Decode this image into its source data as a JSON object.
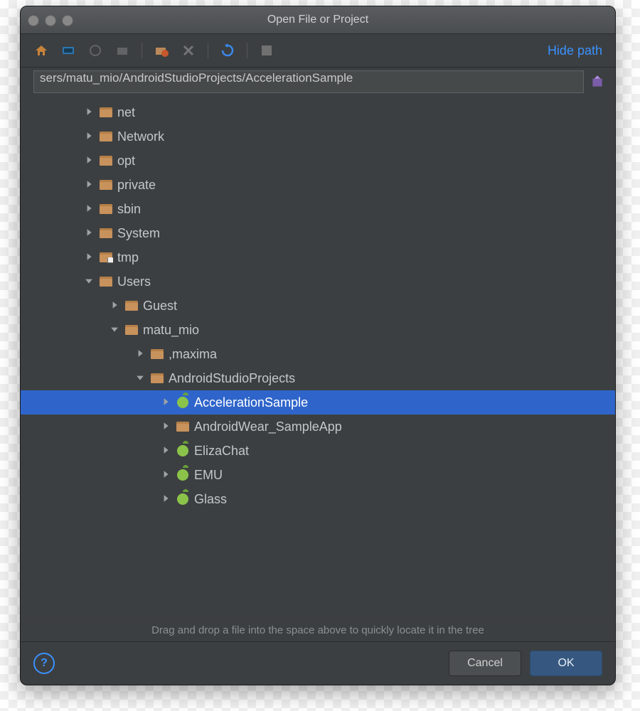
{
  "window": {
    "title": "Open File or Project"
  },
  "toolbar": {
    "hide_path_label": "Hide path"
  },
  "path": {
    "value": "sers/matu_mio/AndroidStudioProjects/AccelerationSample"
  },
  "tree": {
    "items": [
      {
        "indent": 1,
        "expanded": false,
        "icon": "folder",
        "label": "net"
      },
      {
        "indent": 1,
        "expanded": false,
        "icon": "folder",
        "label": "Network"
      },
      {
        "indent": 1,
        "expanded": false,
        "icon": "folder",
        "label": "opt"
      },
      {
        "indent": 1,
        "expanded": false,
        "icon": "folder",
        "label": "private"
      },
      {
        "indent": 1,
        "expanded": false,
        "icon": "folder",
        "label": "sbin"
      },
      {
        "indent": 1,
        "expanded": false,
        "icon": "folder",
        "label": "System"
      },
      {
        "indent": 1,
        "expanded": false,
        "icon": "folder-shortcut",
        "label": "tmp"
      },
      {
        "indent": 1,
        "expanded": true,
        "icon": "folder",
        "label": "Users"
      },
      {
        "indent": 2,
        "expanded": false,
        "icon": "folder",
        "label": "Guest"
      },
      {
        "indent": 2,
        "expanded": true,
        "icon": "folder",
        "label": "matu_mio"
      },
      {
        "indent": 3,
        "expanded": false,
        "icon": "folder",
        "label": ",maxima"
      },
      {
        "indent": 3,
        "expanded": true,
        "icon": "folder",
        "label": "AndroidStudioProjects"
      },
      {
        "indent": 4,
        "expanded": false,
        "icon": "android",
        "label": "AccelerationSample",
        "selected": true
      },
      {
        "indent": 4,
        "expanded": false,
        "icon": "folder",
        "label": "AndroidWear_SampleApp"
      },
      {
        "indent": 4,
        "expanded": false,
        "icon": "android",
        "label": "ElizaChat"
      },
      {
        "indent": 4,
        "expanded": false,
        "icon": "android",
        "label": "EMU"
      },
      {
        "indent": 4,
        "expanded": false,
        "icon": "android",
        "label": "Glass"
      }
    ]
  },
  "hint": {
    "text": "Drag and drop a file into the space above to quickly locate it in the tree"
  },
  "footer": {
    "cancel_label": "Cancel",
    "ok_label": "OK"
  }
}
